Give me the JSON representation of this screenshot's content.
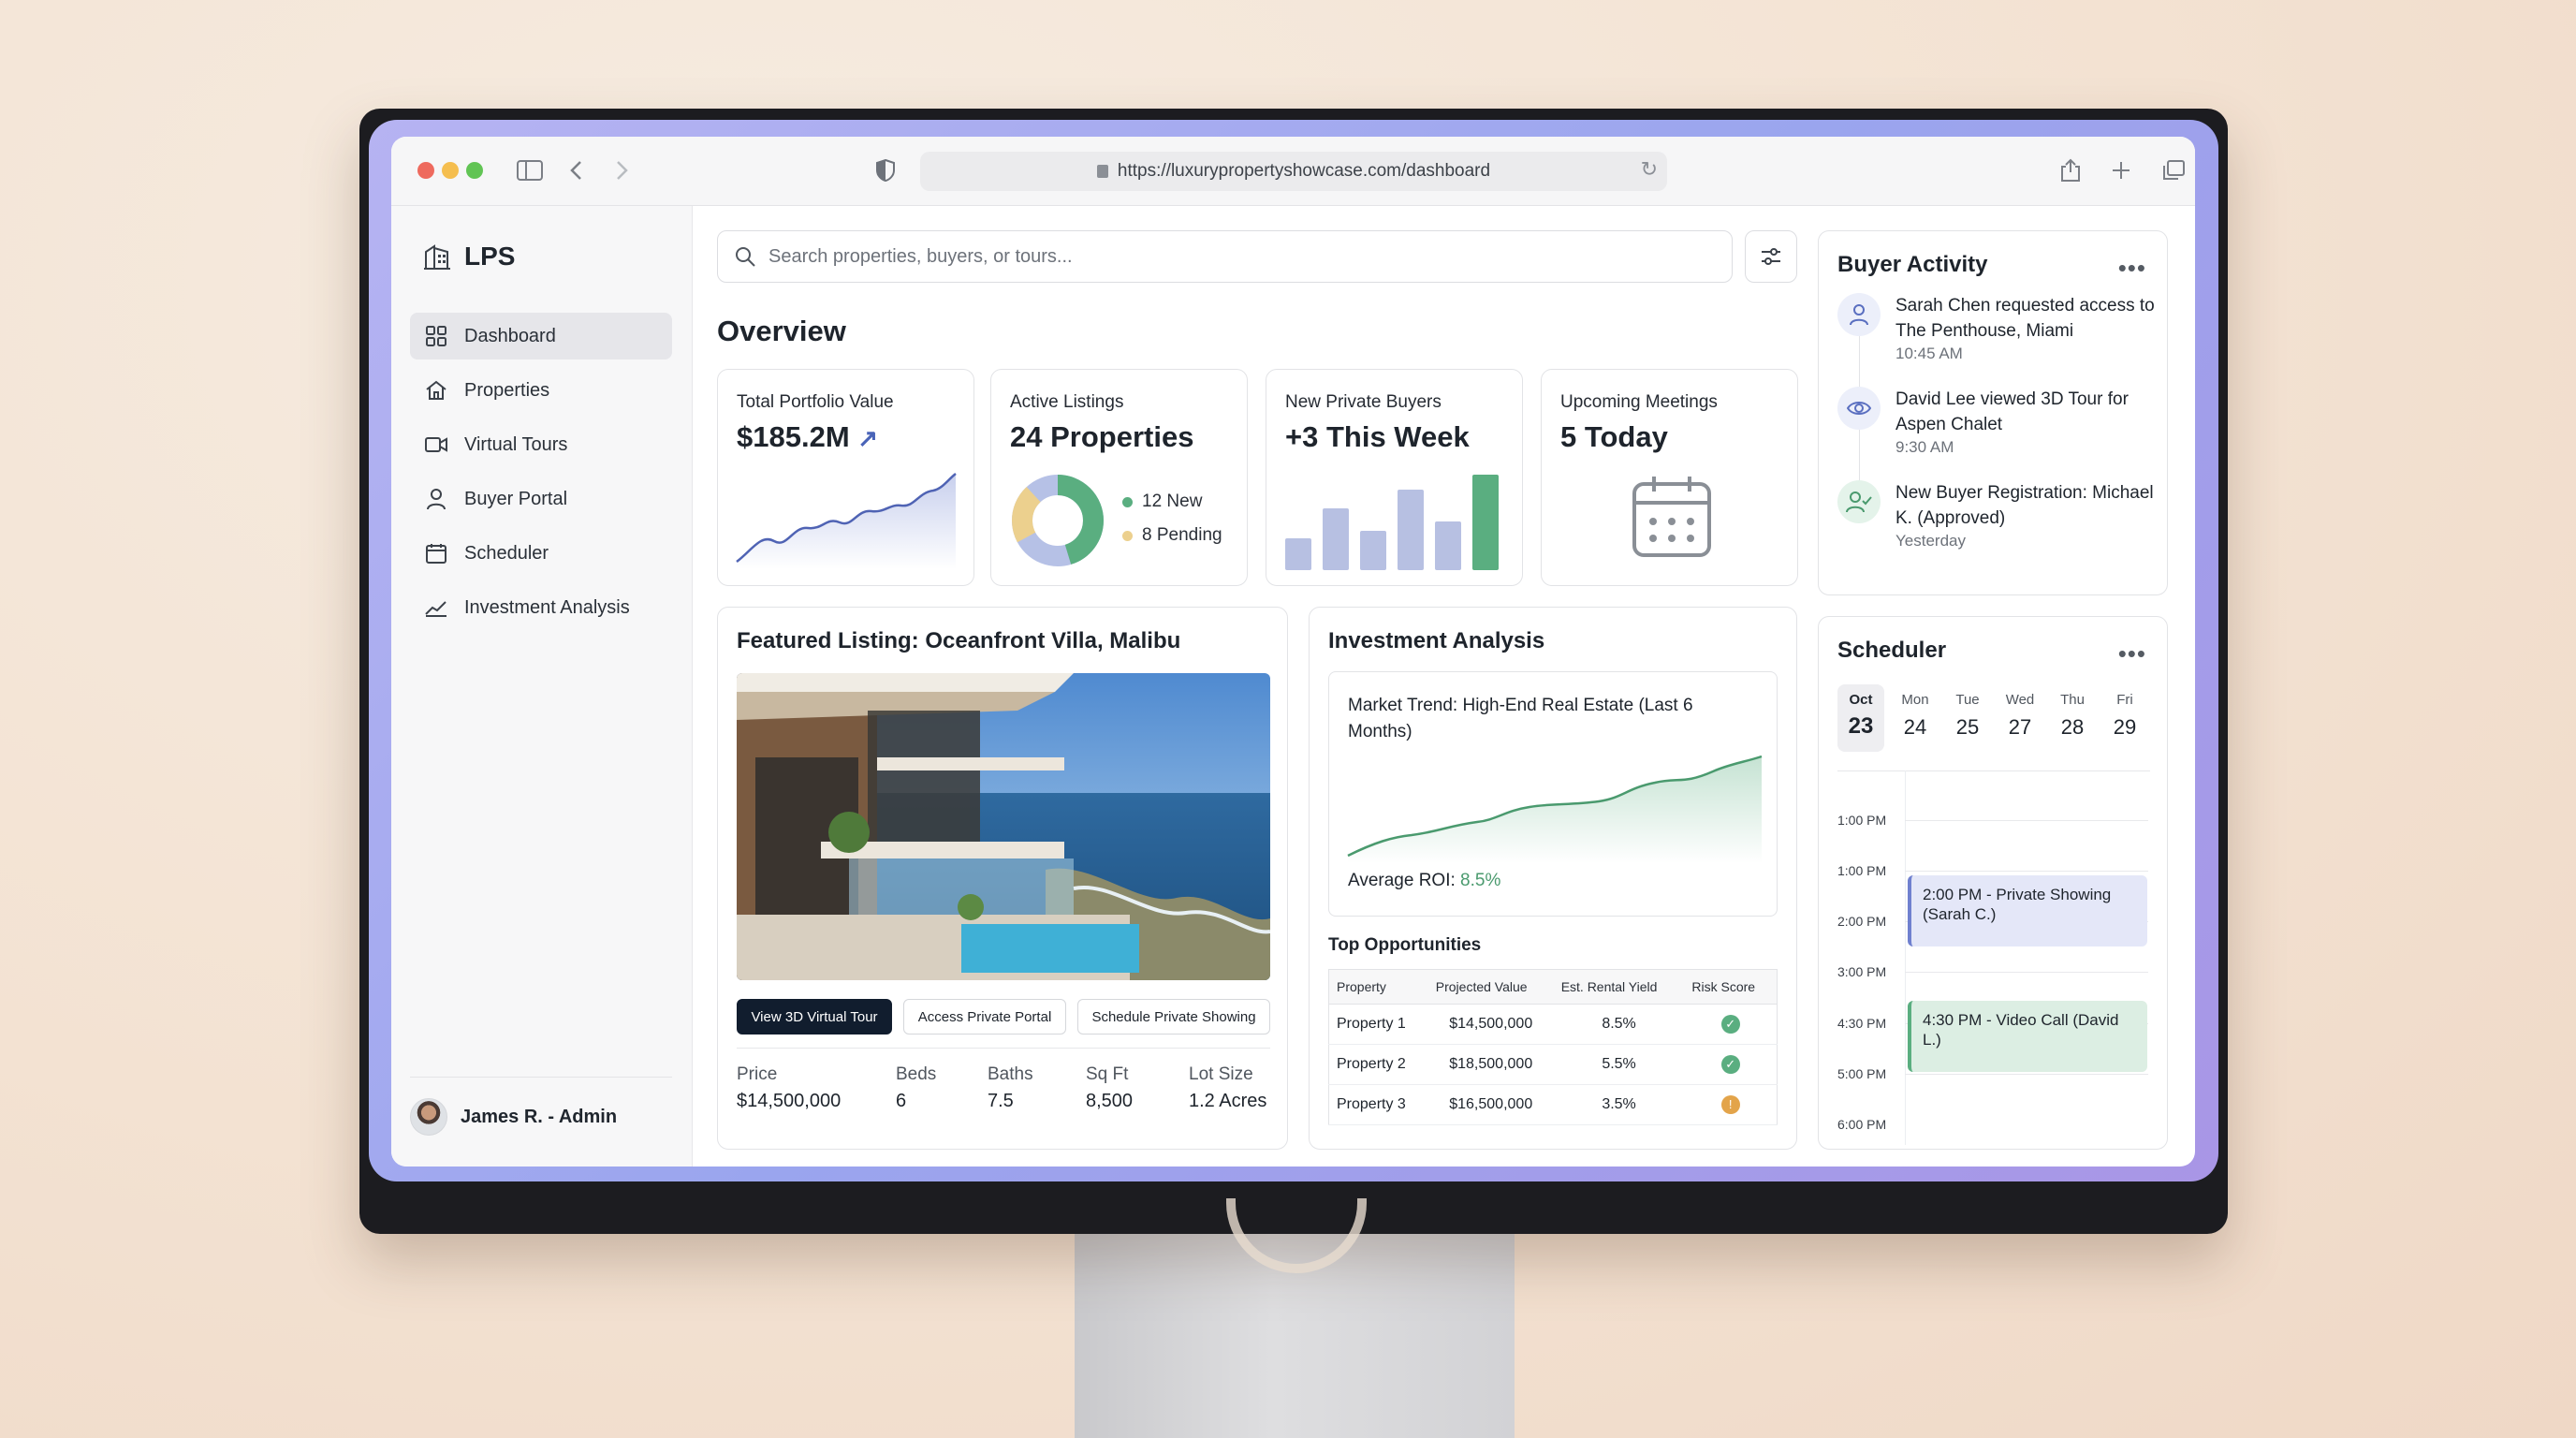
{
  "browser": {
    "url": "https://luxurypropertyshowcase.com/dashboard"
  },
  "sidebar": {
    "logo": "LPS",
    "items": [
      {
        "label": "Dashboard",
        "icon": "grid-icon",
        "active": true
      },
      {
        "label": "Properties",
        "icon": "home-icon"
      },
      {
        "label": "Virtual Tours",
        "icon": "video-icon"
      },
      {
        "label": "Buyer Portal",
        "icon": "user-icon"
      },
      {
        "label": "Scheduler",
        "icon": "calendar-icon"
      },
      {
        "label": "Investment Analysis",
        "icon": "trend-icon"
      }
    ],
    "user": "James R. - Admin"
  },
  "search": {
    "placeholder": "Search properties, buyers, or tours..."
  },
  "overview": {
    "title": "Overview",
    "stats": [
      {
        "label": "Total Portfolio Value",
        "value": "$185.2M"
      },
      {
        "label": "Active Listings",
        "value": "24 Properties",
        "legend": [
          "12 New",
          "8 Pending"
        ]
      },
      {
        "label": "New Private Buyers",
        "value": "+3 This Week"
      },
      {
        "label": "Upcoming Meetings",
        "value": "5 Today"
      }
    ]
  },
  "featured": {
    "title": "Featured Listing: Oceanfront Villa, Malibu",
    "buttons": [
      "View 3D Virtual Tour",
      "Access Private Portal",
      "Schedule Private Showing"
    ],
    "specs": [
      {
        "k": "Price",
        "v": "$14,500,000"
      },
      {
        "k": "Beds",
        "v": "6"
      },
      {
        "k": "Baths",
        "v": "7.5"
      },
      {
        "k": "Sq Ft",
        "v": "8,500"
      },
      {
        "k": "Lot Size",
        "v": "1.2 Acres"
      }
    ]
  },
  "investment": {
    "title": "Investment Analysis",
    "chart_title": "Market Trend: High-End Real Estate (Last 6 Months)",
    "roi_label": "Average ROI:",
    "roi_value": "8.5%",
    "opps_title": "Top Opportunities",
    "headers": [
      "Property",
      "Projected Value",
      "Est. Rental Yield",
      "Risk Score"
    ],
    "rows": [
      {
        "property": "Property 1",
        "value": "$14,500,000",
        "yield": "8.5%",
        "risk": "low"
      },
      {
        "property": "Property 2",
        "value": "$18,500,000",
        "yield": "5.5%",
        "risk": "low"
      },
      {
        "property": "Property 3",
        "value": "$16,500,000",
        "yield": "3.5%",
        "risk": "medium"
      }
    ]
  },
  "activity": {
    "title": "Buyer Activity",
    "items": [
      {
        "text": "Sarah Chen requested access to The Penthouse, Miami",
        "time": "10:45 AM",
        "icon": "user-icon"
      },
      {
        "text": "David Lee viewed 3D Tour for Aspen Chalet",
        "time": "9:30 AM",
        "icon": "eye-icon"
      },
      {
        "text": "New Buyer Registration: Michael K. (Approved)",
        "time": "Yesterday",
        "icon": "user-check-icon"
      }
    ]
  },
  "scheduler": {
    "title": "Scheduler",
    "days": [
      {
        "name": "Oct",
        "date": "23"
      },
      {
        "name": "Mon",
        "date": "24"
      },
      {
        "name": "Tue",
        "date": "25"
      },
      {
        "name": "Wed",
        "date": "27"
      },
      {
        "name": "Thu",
        "date": "28"
      },
      {
        "name": "Fri",
        "date": "29"
      }
    ],
    "times": [
      "1:00 PM",
      "1:00 PM",
      "2:00 PM",
      "3:00 PM",
      "4:30 PM",
      "5:00 PM",
      "6:00 PM"
    ],
    "events": [
      {
        "text": "2:00 PM - Private Showing (Sarah C.)"
      },
      {
        "text": "4:30 PM - Video Call (David L.)"
      }
    ]
  },
  "colors": {
    "accent_dark": "#111d2e",
    "green": "#5aae80",
    "blue_line": "#5a6fc0",
    "amber": "#e3a44a",
    "violet_bars": "#b7c0e2"
  }
}
